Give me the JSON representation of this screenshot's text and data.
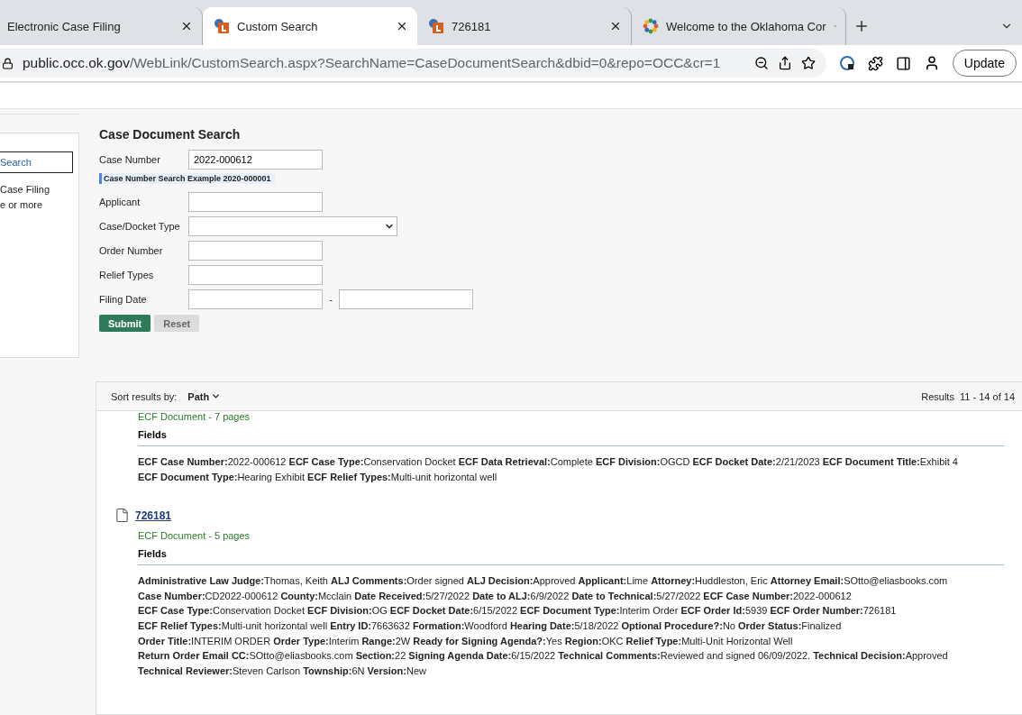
{
  "tabs": [
    {
      "title": "Electronic Case Filing",
      "kind": "plain",
      "selected": false
    },
    {
      "title": "Custom Search",
      "kind": "site",
      "selected": true
    },
    {
      "title": "726181",
      "kind": "site",
      "selected": false
    },
    {
      "title": "Welcome to the Oklahoma Cor",
      "kind": "seal",
      "selected": false
    }
  ],
  "address": {
    "host": "public.occ.ok.gov",
    "path": "/WebLink/CustomSearch.aspx?SearchName=CaseDocumentSearch&dbid=0&repo=OCC&cr=1"
  },
  "update_button": "Update",
  "sidebar": {
    "items": [
      {
        "label": "Search",
        "selected": true
      },
      {
        "label": "Case Filing",
        "selected": false
      },
      {
        "label": "e or more",
        "selected": false
      }
    ]
  },
  "form": {
    "title": "Case Document Search",
    "rows": [
      {
        "kind": "text",
        "label": "Case Number",
        "value": "2022-000612"
      },
      {
        "kind": "hint",
        "text": "Case Number Search Example 2020-000001"
      },
      {
        "kind": "text",
        "label": "Applicant"
      },
      {
        "kind": "select",
        "label": "Case/Docket Type"
      },
      {
        "kind": "text",
        "label": "Order Number"
      },
      {
        "kind": "text",
        "label": "Relief Types"
      },
      {
        "kind": "daterange",
        "label": "Filing Date",
        "separator": "-"
      }
    ],
    "submit": "Submit",
    "reset": "Reset"
  },
  "results": {
    "sort_label": "Sort results by:",
    "sort_value": "Path",
    "count": "Results  11 - 14 of 14",
    "items": [
      {
        "meta": "ECF Document - 7 pages",
        "fields_heading": "Fields",
        "lines": [
          "**ECF Case Number:**2022-000612 **ECF Case Type:**Conservation Docket **ECF Data Retrieval:**Complete **ECF Division:**OGCD **ECF Docket Date:**2/21/2023 **ECF Document Title:**Exhibit 4",
          "**ECF Document Type:**Hearing Exhibit **ECF Relief Types:**Multi-unit horizontal well"
        ]
      },
      {
        "title": "726181",
        "meta": "ECF Document - 5 pages",
        "fields_heading": "Fields",
        "lines": [
          "**Administrative Law Judge:**Thomas, Keith **ALJ Comments:**Order signed **ALJ Decision:**Approved **Applicant:**Lime **Attorney:**Huddleston, Eric **Attorney Email:**SOtto@eliasbooks.com",
          "**Case Number:**CD2022-000612 **County:**Mcclain **Date Received:**5/27/2022 **Date to ALJ:**6/9/2022 **Date to Technical:**5/27/2022 **ECF Case Number:**2022-000612",
          "**ECF Case Type:**Conservation Docket **ECF Division:**OG **ECF Docket Date:**6/15/2022 **ECF Document Type:**Interim Order **ECF Order Id:**5939 **ECF Order Number:**726181",
          "**ECF Relief Types:**Multi-unit horizontal well **Entry ID:**7663632 **Formation:**Woodford **Hearing Date:**5/18/2022 **Optional Procedure?:**No **Order Status:**Finalized",
          "**Order Title:**INTERIM ORDER **Order Type:**Interim **Range:**2W **Ready for Signing Agenda?:**Yes **Region:**OKC **Relief Type:**Multi-Unit Horizontal Well",
          "**Return Order Email CC:**SOtto@eliasbooks.com **Section:**22 **Signing Agenda Date:**6/15/2022 **Technical Comments:**Reviewed and signed 06/09/2022. **Technical Decision:**Approved",
          "**Technical Reviewer:**Steven Carlson **Township:**6N **Version:**New"
        ]
      }
    ]
  }
}
